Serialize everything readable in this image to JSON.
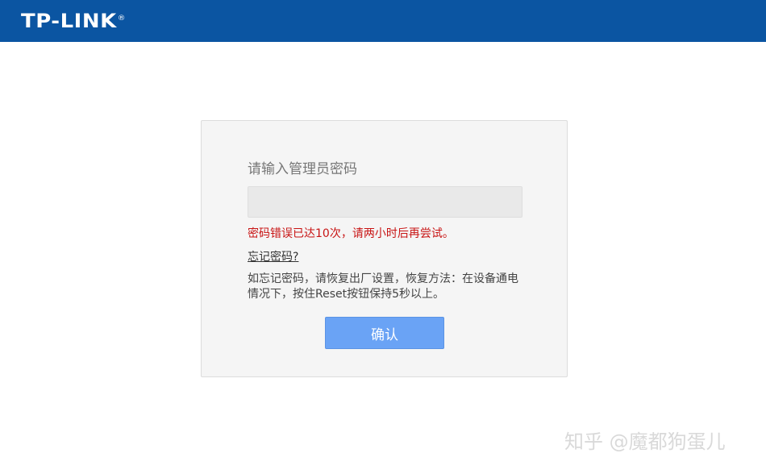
{
  "header": {
    "logo_text": "TP-LINK",
    "logo_reg": "®"
  },
  "login": {
    "password_label": "请输入管理员密码",
    "password_value": "",
    "error_message": "密码错误已达10次，请两小时后再尝试。",
    "forgot_link": "忘记密码?",
    "help_text": "如忘记密码，请恢复出厂设置，恢复方法：在设备通电情况下，按住Reset按钮保持5秒以上。",
    "confirm_label": "确认"
  },
  "watermark": {
    "text": "知乎 @魔都狗蛋儿"
  },
  "colors": {
    "header_bg": "#0b55a2",
    "error_text": "#c81414",
    "button_bg": "#6aa3f5"
  }
}
